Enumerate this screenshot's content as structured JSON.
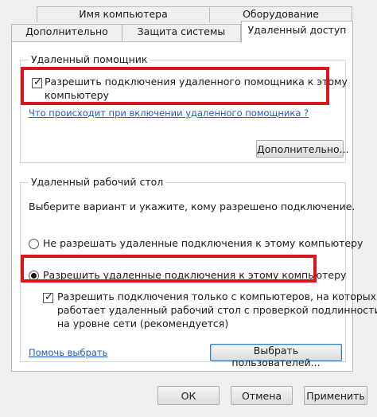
{
  "tabs": {
    "row1": [
      {
        "label": "Имя компьютера"
      },
      {
        "label": "Оборудование"
      }
    ],
    "row2": [
      {
        "label": "Дополнительно"
      },
      {
        "label": "Защита системы"
      },
      {
        "label": "Удаленный доступ"
      }
    ]
  },
  "remote_assistance": {
    "group_label": "Удаленный помощник",
    "allow_checkbox": {
      "label_line1": "Разрешить подключения удаленного помощника к этому",
      "label_line2": "компьютеру",
      "checked": true
    },
    "help_link": "Что происходит при включении удаленного помощника ?",
    "advanced_button": "Дополнительно..."
  },
  "remote_desktop": {
    "group_label": "Удаленный рабочий стол",
    "instruction": "Выберите вариант и укажите, кому разрешено подключение.",
    "option_deny": "Не разрешать удаленные подключения к этому компьютеру",
    "option_allow": "Разрешить удаленные подключения к этому компьютеру",
    "selected_option": "allow",
    "nla_checkbox": {
      "line1": "Разрешить подключения только с компьютеров, на которых",
      "line2": "работает удаленный рабочий стол с проверкой подлинности",
      "line3": "на уровне сети (рекомендуется)",
      "checked": true
    },
    "help_link": "Помочь выбрать",
    "select_users_button": "Выбрать пользователей..."
  },
  "footer": {
    "ok": "ОК",
    "cancel": "Отмена",
    "apply": "Применить"
  },
  "colors": {
    "highlight_box": "#d6171f",
    "link": "#1a5dc8"
  }
}
